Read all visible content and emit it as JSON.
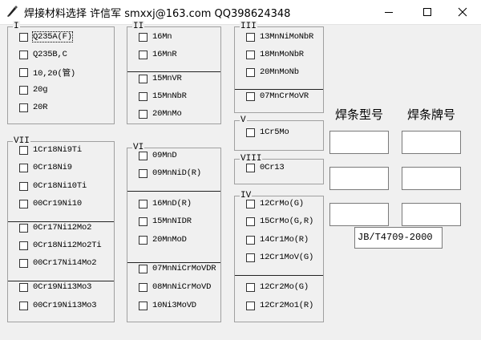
{
  "window": {
    "title": "焊接材料选择   许信军  smxxj@163.com  QQ398624348"
  },
  "groups": {
    "g1": {
      "legend": "I",
      "sections": [
        [
          "Q235A(F)",
          "Q235B,C",
          "10,20(管)",
          "20g",
          "20R"
        ]
      ]
    },
    "g2": {
      "legend": "II",
      "sections": [
        [
          "16Mn",
          "16MnR"
        ],
        [
          "15MnVR",
          "15MnNbR",
          "20MnMo"
        ]
      ]
    },
    "g3": {
      "legend": "III",
      "sections": [
        [
          "13MnNiMoNbR",
          "18MnMoNbR",
          "20MnMoNb"
        ],
        [
          "07MnCrMoVR"
        ]
      ]
    },
    "g5": {
      "legend": "V",
      "sections": [
        [
          "1Cr5Mo"
        ]
      ]
    },
    "g8": {
      "legend": "VIII",
      "sections": [
        [
          "0Cr13"
        ]
      ]
    },
    "g7": {
      "legend": "VII",
      "sections": [
        [
          "1Cr18Ni9Ti",
          "0Cr18Ni9",
          "0Cr18Ni10Ti",
          "00Cr19Ni10"
        ],
        [
          "0Cr17Ni12Mo2",
          "0Cr18Ni12Mo2Ti",
          "00Cr17Ni14Mo2"
        ],
        [
          "0Cr19Ni13Mo3",
          "00Cr19Ni13Mo3"
        ]
      ]
    },
    "g6": {
      "legend": "VI",
      "sections": [
        [
          "09MnD",
          "09MnNiD(R)"
        ],
        [
          "16MnD(R)",
          "15MnNIDR",
          "20MnMoD"
        ],
        [
          "07MnNiCrMoVDR",
          "08MnNiCrMoVD",
          "10Ni3MoVD"
        ]
      ]
    },
    "g4": {
      "legend": "IV",
      "sections": [
        [
          "12CrMo(G)",
          "15CrMo(G,R)",
          "14Cr1Mo(R)",
          "12Cr1MoV(G)"
        ],
        [
          "12Cr2Mo(G)",
          "12Cr2Mo1(R)"
        ]
      ]
    }
  },
  "results": {
    "model_heading": "焊条型号",
    "brand_heading": "焊条牌号",
    "standard": "JB/T4709-2000"
  }
}
